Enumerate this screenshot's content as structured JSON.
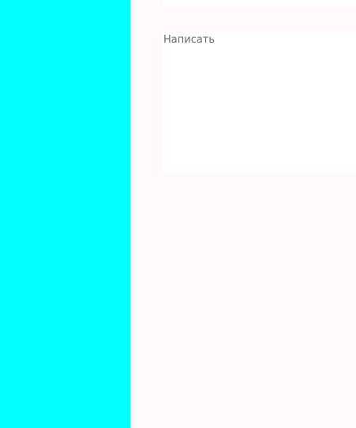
{
  "colors": {
    "sidebar": "#00ffff",
    "page_background": "#fffaf9",
    "panel": "#ffffff",
    "placeholder_text": "#6b6b6b"
  },
  "compose": {
    "value": "",
    "placeholder": "Написать"
  }
}
